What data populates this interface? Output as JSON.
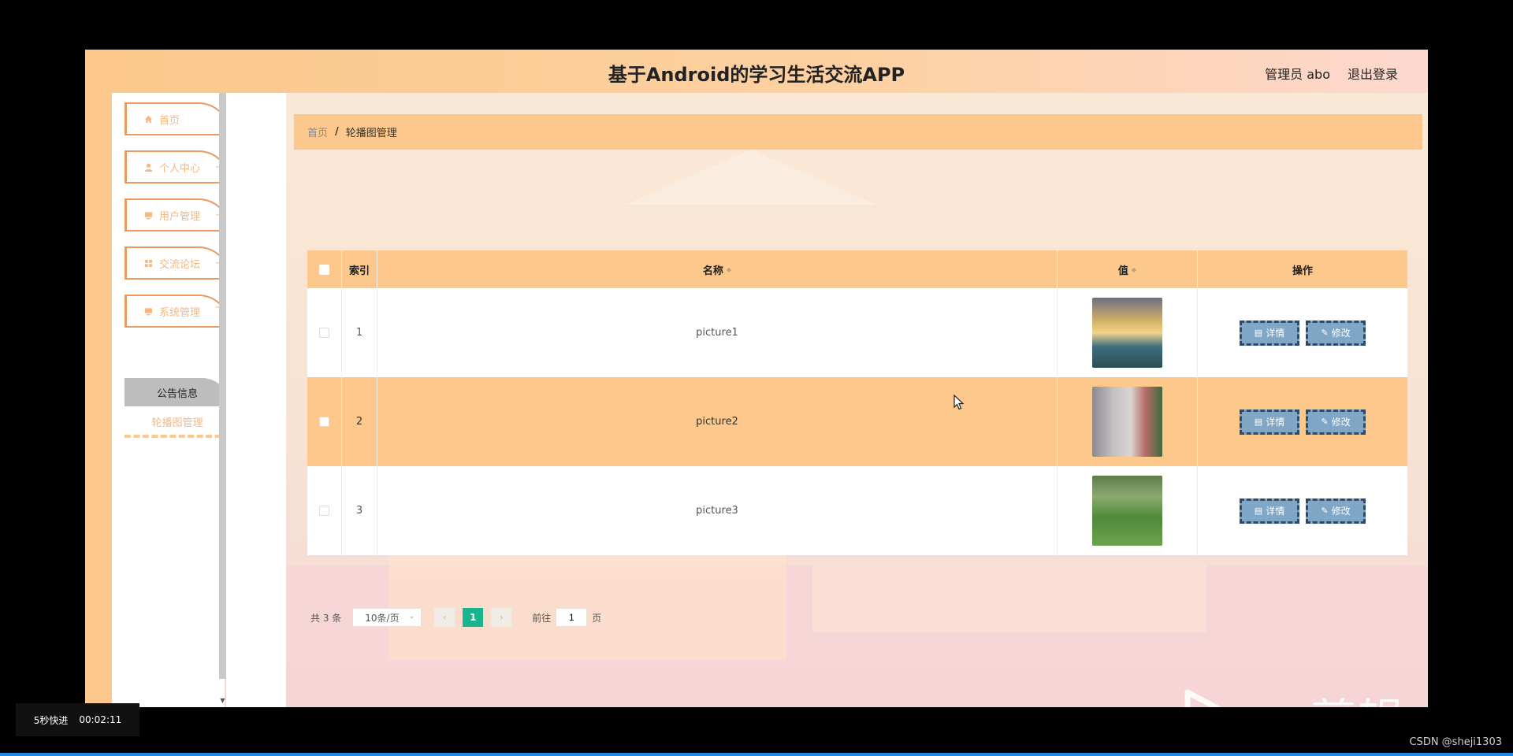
{
  "app": {
    "title": "基于Android的学习生活交流APP",
    "user": "管理员 abo",
    "logout": "退出登录"
  },
  "sidebar": {
    "items": [
      {
        "label": "首页",
        "icon": "home-icon"
      },
      {
        "label": "个人中心",
        "icon": "user-icon"
      },
      {
        "label": "用户管理",
        "icon": "monitor-icon"
      },
      {
        "label": "交流论坛",
        "icon": "grid-icon"
      },
      {
        "label": "系统管理",
        "icon": "monitor-icon"
      }
    ],
    "sub_items": [
      {
        "label": "公告信息"
      },
      {
        "label": "轮播图管理"
      }
    ]
  },
  "breadcrumb": {
    "home": "首页",
    "separator": "/",
    "current": "轮播图管理"
  },
  "table": {
    "headers": {
      "index": "索引",
      "name": "名称",
      "value": "值",
      "ops": "操作"
    },
    "rows": [
      {
        "index": "1",
        "name": "picture1"
      },
      {
        "index": "2",
        "name": "picture2"
      },
      {
        "index": "3",
        "name": "picture3"
      }
    ],
    "buttons": {
      "detail": "详情",
      "edit": "修改"
    }
  },
  "pagination": {
    "total": "共 3 条",
    "page_size": "10条/页",
    "current_page": "1",
    "goto_label": "前往",
    "goto_value": "1",
    "page_unit": "页"
  },
  "watermark": {
    "text": "ev剪辑"
  },
  "overlay": {
    "fast_forward": "5秒快进",
    "timestamp": "00:02:11",
    "credit": "CSDN @sheji1303"
  },
  "colors": {
    "accent": "#fcc88b",
    "menu_border": "#e99a5f",
    "button": "#7fa6c4",
    "page_active": "#16b48f"
  }
}
